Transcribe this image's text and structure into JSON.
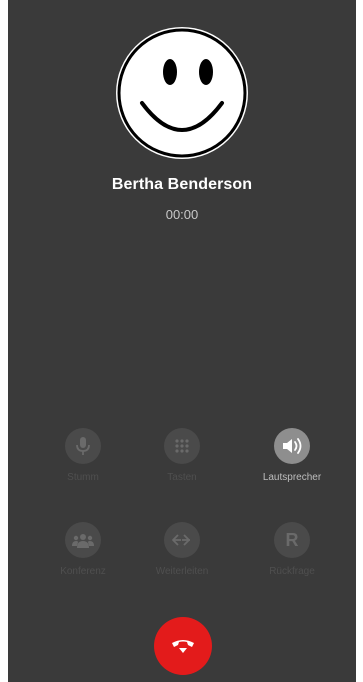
{
  "caller": {
    "name": "Bertha Benderson",
    "timer": "00:00",
    "avatar_icon": "smiley-face-icon"
  },
  "actions": {
    "mute": {
      "label": "Stumm",
      "icon": "microphone-icon",
      "active": false
    },
    "keypad": {
      "label": "Tasten",
      "icon": "keypad-icon",
      "active": false
    },
    "speaker": {
      "label": "Lautsprecher",
      "icon": "speaker-icon",
      "active": true
    },
    "conference": {
      "label": "Konferenz",
      "icon": "group-icon",
      "active": false
    },
    "transfer": {
      "label": "Weiterleiten",
      "icon": "transfer-icon",
      "active": false
    },
    "consultation": {
      "label": "Rückfrage",
      "icon": "r-letter-icon",
      "glyph": "R",
      "active": false
    }
  },
  "hangup": {
    "icon": "hang-up-icon"
  },
  "colors": {
    "background": "#3a3a3a",
    "hangup": "#e31b1b",
    "button_disabled": "#4a4a4a",
    "button_active": "#8e8e8e"
  }
}
